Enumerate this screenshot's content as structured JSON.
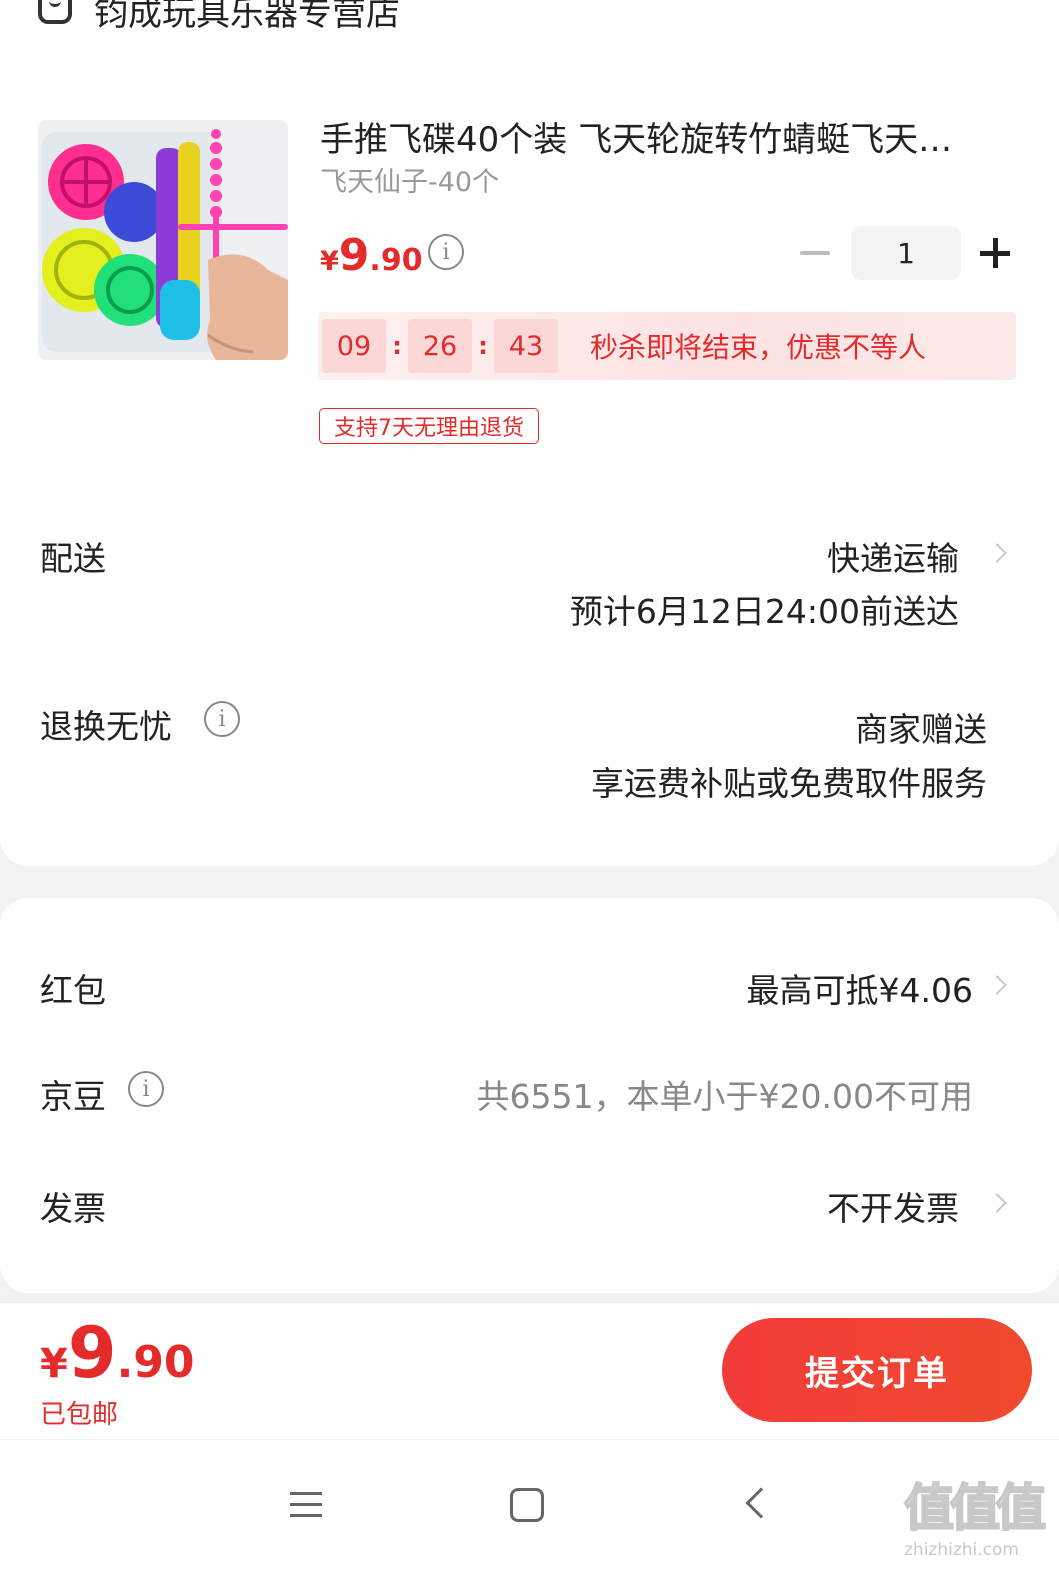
{
  "shop": {
    "name": "钧成玩具乐器专营店",
    "icon": "shop-icon"
  },
  "product": {
    "title": "手推飞碟40个装 飞天轮旋转竹蜻蜓飞天…",
    "spec": "飞天仙子-40个",
    "price": {
      "currency": "¥",
      "integer": "9",
      "decimal": ".90"
    },
    "quantity": "1",
    "flash_sale": {
      "hours": "09",
      "minutes": "26",
      "seconds": "43",
      "separator": ":",
      "text": "秒杀即将结束，优惠不等人"
    },
    "return_tag": "支持7天无理由退货"
  },
  "delivery": {
    "label": "配送",
    "method": "快递运输",
    "eta": "预计6月12日24:00前送达"
  },
  "return_service": {
    "label": "退换无忧",
    "title": "商家赠送",
    "desc": "享运费补贴或免费取件服务"
  },
  "discounts": {
    "red_packet": {
      "label": "红包",
      "value": "最高可抵¥4.06"
    },
    "jingdou": {
      "label": "京豆",
      "value": "共6551，本单小于¥20.00不可用"
    },
    "invoice": {
      "label": "发票",
      "value": "不开发票"
    }
  },
  "footer": {
    "total": {
      "currency": "¥",
      "integer": "9",
      "decimal": ".90"
    },
    "shipping_note": "已包邮",
    "submit_label": "提交订单"
  },
  "watermark": {
    "glyph": "值值值",
    "url": "zhizhizhi.com"
  },
  "colors": {
    "accent": "#e42a2a",
    "submit_gradient_start": "#f23b3b",
    "submit_gradient_end": "#f04a2e",
    "page_bg": "#f2f2f2"
  }
}
